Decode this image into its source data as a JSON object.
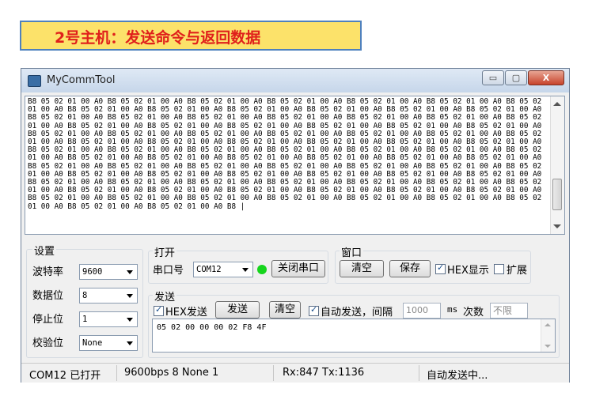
{
  "banner": {
    "text": "2号主机：发送命令与返回数据"
  },
  "window": {
    "title": "MyCommTool",
    "controls": {
      "minimize": "▭",
      "maximize": "▢",
      "close": "X"
    }
  },
  "receive": {
    "text": "B8 05 02 01 00 A0 B8 05 02 01 00 A0 B8 05 02 01 00 A0 B8 05 02 01 00 A0 B8 05 02 01 00 A0 B8 05 02 01 00 A0 B8 05 02 01 00 A0 B8 05 02 01 00 A0 B8 05 02 01 00 A0 B8 05 02 01 00 A0 B8 05 02 01 00 A0 B8 05 02 01 00 A0 B8 05 02 01 00 A0 B8 05 02 01 00 A0 B8 05 02 01 00 A0 B8 05 02 01 00 A0 B8 05 02 01 00 A0 B8 05 02 01 00 A0 B8 05 02 01 00 A0 B8 05 02 01 00 A0 B8 05 02 01 00 A0 B8 05 02 01 00 A0 B8 05 02 01 00 A0 B8 05 02 01 00 A0 B8 05 02 01 00 A0 B8 05 02 01 00 A0 B8 05 02 01 00 A0 B8 05 02 01 00 A0 B8 05 02 01 00 A0 B8 05 02 01 00 A0 B8 05 02 01 00 A0 B8 05 02 01 00 A0 B8 05 02 01 00 A0 B8 05 02 01 00 A0 B8 05 02 01 00 A0 B8 05 02 01 00 A0 B8 05 02 01 00 A0 B8 05 02 01 00 A0 B8 05 02 01 00 A0 B8 05 02 01 00 A0 B8 05 02 01 00 A0 B8 05 02 01 00 A0 B8 05 02 01 00 A0 B8 05 02 01 00 A0 B8 05 02 01 00 A0 B8 05 02 01 00 A0 B8 05 02 01 00 A0 B8 05 02 01 00 A0 B8 05 02 01 00 A0 B8 05 02 01 00 A0 B8 05 02 01 00 A0 B8 05 02 01 00 A0 B8 05 02 01 00 A0 B8 05 02 01 00 A0 B8 05 02 01 00 A0 B8 05 02 01 00 A0 B8 05 02 01 00 A0 B8 05 02 01 00 A0 B8 05 02 01 00 A0 B8 05 02 01 00 A0 B8 05 02 01 00 A0 B8 05 02 01 00 A0 B8 05 02 01 00 A0 B8 05 02 01 00 A0 B8 05 02 01 00 A0 B8 05 02 01 00 A0 B8 05 02 01 00 A0 B8 05 02 01 00 A0 B8 05 02 01 00 A0 B8 05 02 01 00 A0 B8 05 02 01 00 A0 B8 05 02 01 00 A0 B8 05 02 01 00 A0 B8 05 02 01 00 A0 B8 05 02 01 00 A0 B8 05 02 01 00 A0 B8 05 02 01 00 A0 B8 05 02 01 00 A0 B8 05 02 01 00 A0 B8 05 02 01 00 A0 B8 05 02 01 00 A0 B8 05 02 01 00 A0 B8 05 02 01 00 A0 B8 05 02 01 00 A0 B8 05 02 01 00 A0 B8 05 02 01 00 A0 B8 05 02 01 00 A0 B8 |"
  },
  "settings": {
    "title": "设置",
    "baud_label": "波特率",
    "baud_value": "9600",
    "databits_label": "数据位",
    "databits_value": "8",
    "stopbits_label": "停止位",
    "stopbits_value": "1",
    "parity_label": "校验位",
    "parity_value": "None"
  },
  "open": {
    "title": "打开",
    "port_label": "串口号",
    "port_value": "COM12",
    "close_button": "关闭串口",
    "led_color": "#16d51d"
  },
  "windowgrp": {
    "title": "窗口",
    "clear_button": "清空",
    "save_button": "保存",
    "hex_display_label": "HEX显示",
    "hex_display_checked": true,
    "extend_label": "扩展",
    "extend_checked": false
  },
  "send": {
    "title": "发送",
    "hex_send_label": "HEX发送",
    "hex_send_checked": true,
    "send_button": "发送",
    "clear_button": "清空",
    "auto_send_label": "自动发送，间隔",
    "auto_send_checked": true,
    "interval_value": "1000",
    "interval_unit": "ms",
    "count_label": "次数",
    "count_value": "不限",
    "data": "05 02 00 00 00 02 F8 4F"
  },
  "status": {
    "port": "COM12 已打开",
    "config": "9600bps  8  None  1",
    "counters": "Rx:847  Tx:1136",
    "state": "自动发送中..."
  }
}
